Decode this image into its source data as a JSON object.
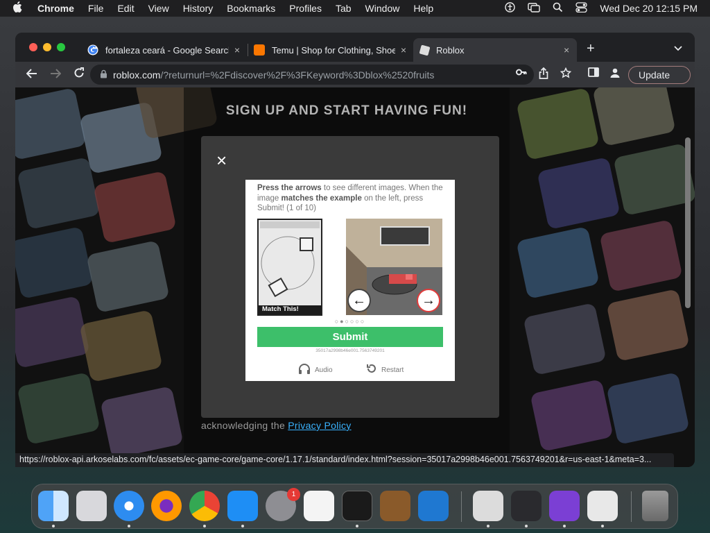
{
  "menubar": {
    "apple": "",
    "app": "Chrome",
    "items": [
      "File",
      "Edit",
      "View",
      "History",
      "Bookmarks",
      "Profiles",
      "Tab",
      "Window",
      "Help"
    ],
    "datetime": "Wed Dec 20  12:15 PM"
  },
  "browser": {
    "tabs": [
      {
        "title": "fortaleza ceará - Google Search",
        "close": "×"
      },
      {
        "title": "Temu | Shop for Clothing, Shoes",
        "close": "×"
      },
      {
        "title": "Roblox",
        "close": "×"
      }
    ],
    "new_tab": "+",
    "url_host": "roblox.com",
    "url_path": "/?returnurl=%2Fdiscover%2F%3FKeyword%3Dblox%2520fruits",
    "update_label": "Update"
  },
  "page": {
    "heading": "SIGN UP AND START HAVING FUN!",
    "close": "×",
    "ack_text": "acknowledging the ",
    "privacy_link": "Privacy Policy"
  },
  "captcha": {
    "instr_1": "Press the arrows",
    "instr_2": " to see different images. When the image ",
    "instr_3": "matches the example",
    "instr_4": " on the left, press Submit! (1 of 10)",
    "example_label": "Match This!",
    "left_arrow": "←",
    "right_arrow": "→",
    "pager": "○●○○○○",
    "submit": "Submit",
    "session": "35017a2998b46e001.7563749201",
    "audio": "Audio",
    "restart": "Restart"
  },
  "status_url": "https://roblox-api.arkoselabs.com/fc/assets/ec-game-core/game-core/1.17.1/standard/index.html?session=35017a2998b46e001.7563749201&r=us-east-1&meta=3...",
  "dock": {
    "badge": "1",
    "apps": [
      "finder-icon",
      "launchpad-icon",
      "safari-icon",
      "firefox-icon",
      "chrome-icon",
      "app-store-icon",
      "system-settings-icon",
      "textedit-icon",
      "terminal-icon",
      "garageband-icon",
      "vscode-icon",
      "disk-utility-icon",
      "activity-monitor-icon",
      "storage-icon",
      "accessibility-icon",
      "trash-icon"
    ]
  },
  "colors": {
    "submit_green": "#3dbf6a",
    "link_blue": "#3ab3ff",
    "chrome_dark": "#202124"
  }
}
